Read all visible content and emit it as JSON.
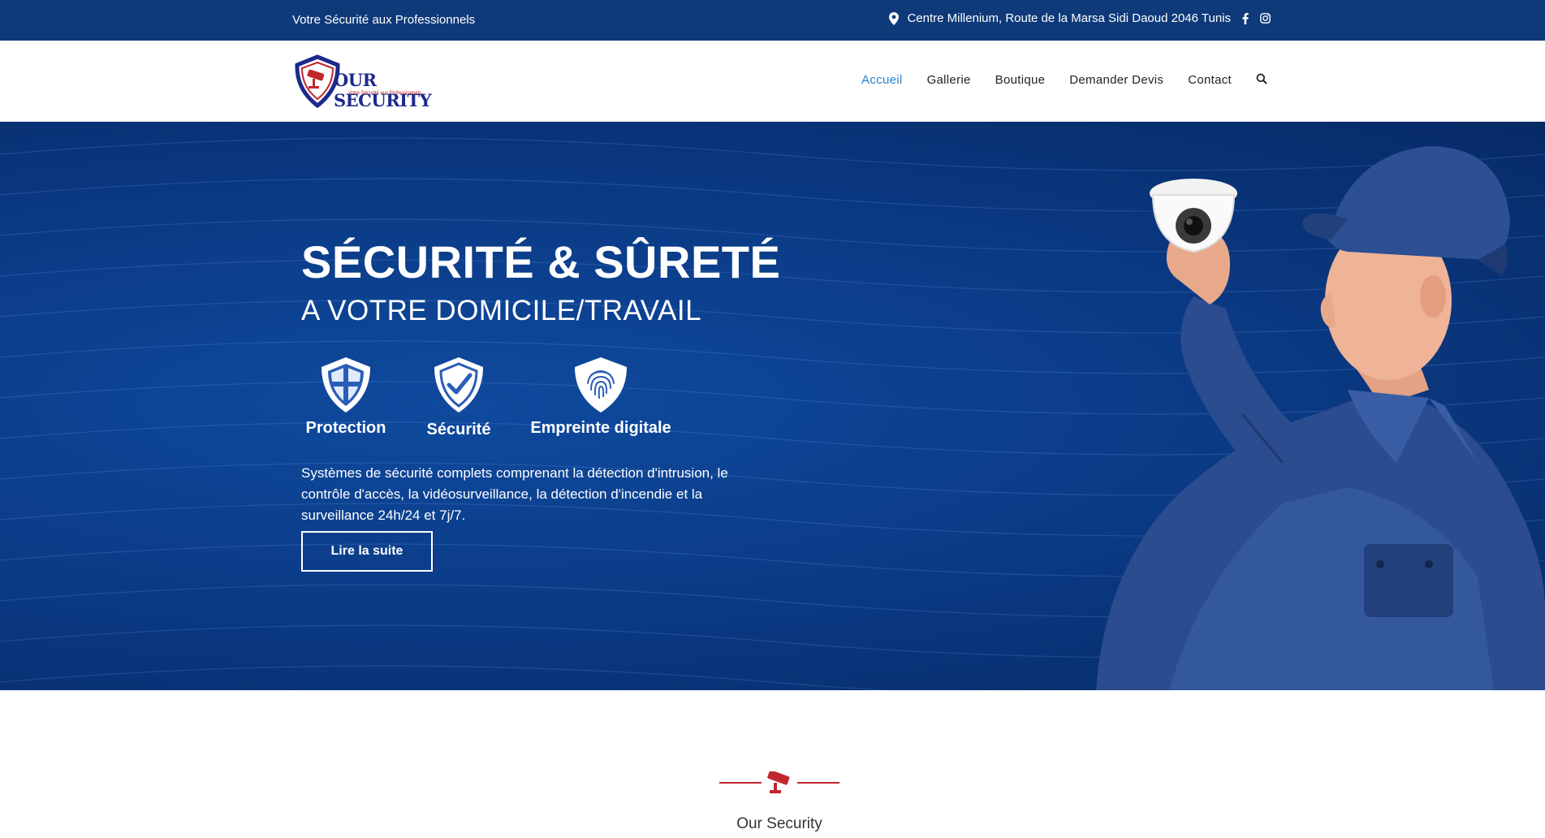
{
  "topbar": {
    "tagline": "Votre Sécurité aux Professionnels",
    "address": "Centre Millenium, Route de la Marsa Sidi Daoud 2046 Tunis",
    "location_icon": "map-pin-icon",
    "social": [
      "facebook-icon",
      "instagram-icon"
    ]
  },
  "header": {
    "logo_text": "OUR SECURITY",
    "logo_subtext": "Votre Sécurité aux Professionnels",
    "nav": [
      {
        "label": "Accueil",
        "active": true
      },
      {
        "label": "Gallerie",
        "active": false
      },
      {
        "label": "Boutique",
        "active": false
      },
      {
        "label": "Demander Devis",
        "active": false
      },
      {
        "label": "Contact",
        "active": false
      }
    ],
    "search_icon": "search-icon"
  },
  "hero": {
    "title": "SÉCURITÉ & SÛRETÉ",
    "subtitle": "A VOTRE DOMICILE/TRAVAIL",
    "features": [
      {
        "label": "Protection",
        "icon": "shield-cross-icon"
      },
      {
        "label": "Sécurité",
        "icon": "shield-check-icon"
      },
      {
        "label": "Empreinte digitale",
        "icon": "shield-fingerprint-icon"
      }
    ],
    "description": "Systèmes de sécurité complets comprenant la détection d'intrusion, le contrôle d'accès, la vidéosurveillance, la détection d'incendie et la surveillance 24h/24 et 7j/7.",
    "cta_label": "Lire la suite"
  },
  "section": {
    "title": "Our Security",
    "divider_icon": "cctv-camera-icon"
  },
  "colors": {
    "topbar": "#0e3a7a",
    "hero": "#0b3c88",
    "accent": "#2c82c9",
    "brand_red": "#c0272d"
  }
}
